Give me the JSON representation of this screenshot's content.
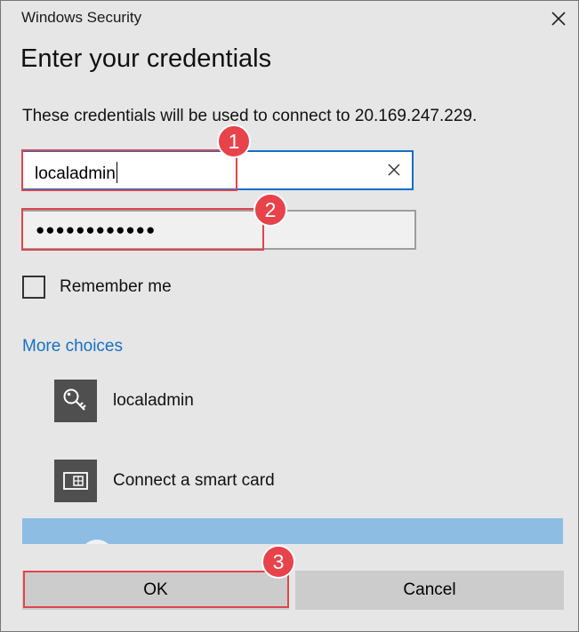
{
  "window": {
    "title": "Windows Security"
  },
  "dialog": {
    "heading": "Enter your credentials",
    "description": "These credentials will be used to connect to 20.169.247.229."
  },
  "username_field": {
    "value": "localadmin"
  },
  "password_field": {
    "masked_value": "●●●●●●●●●●●●"
  },
  "remember_me": {
    "label": "Remember me",
    "checked": false
  },
  "more_choices": {
    "label": "More choices"
  },
  "choices": [
    {
      "label": "localadmin",
      "icon": "key-icon"
    },
    {
      "label": "Connect a smart card",
      "icon": "smart-card-icon"
    }
  ],
  "buttons": {
    "ok": "OK",
    "cancel": "Cancel"
  },
  "annotations": [
    {
      "number": "1"
    },
    {
      "number": "2"
    },
    {
      "number": "3"
    }
  ],
  "colors": {
    "accent": "#0f70c9",
    "link": "#1670c4",
    "annotation": "#e8424a",
    "selection": "#8dbde2",
    "button": "#cccccc",
    "background": "#e6e6e6"
  }
}
